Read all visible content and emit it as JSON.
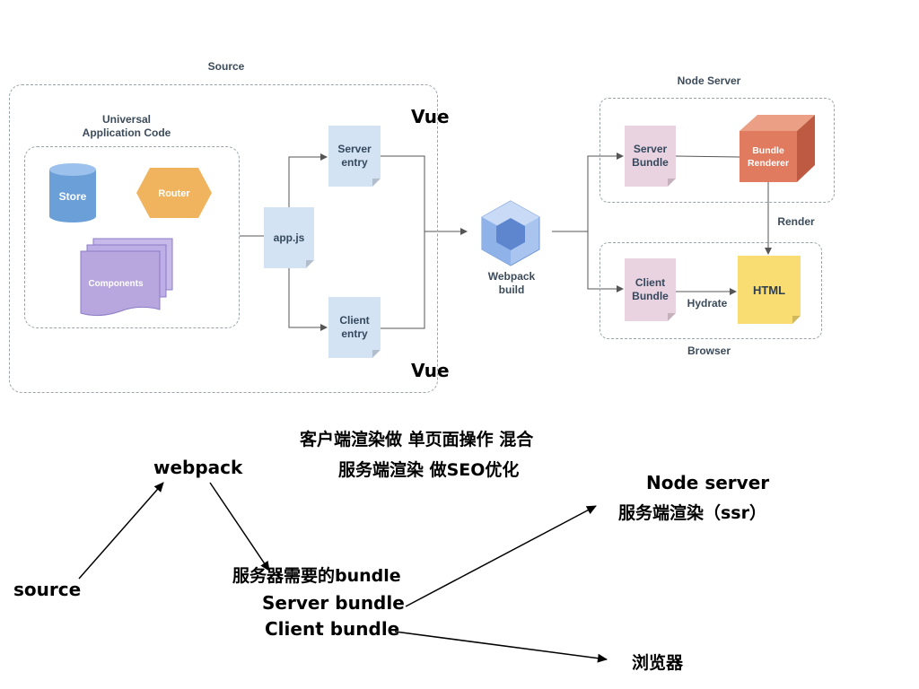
{
  "diagram": {
    "source_label": "Source",
    "universal_label": "Universal Application Code",
    "store": "Store",
    "router": "Router",
    "components": "Components",
    "app_js": "app.js",
    "server_entry": "Server entry",
    "client_entry": "Client entry",
    "vue_top": "Vue",
    "vue_bottom": "Vue",
    "webpack_build": "Webpack build",
    "node_server_label": "Node Server",
    "server_bundle": "Server Bundle",
    "bundle_renderer": "Bundle Renderer",
    "render": "Render",
    "client_bundle": "Client Bundle",
    "hydrate": "Hydrate",
    "html": "HTML",
    "browser_label": "Browser"
  },
  "notes": {
    "line1": "客户端渲染做 单页面操作  混合",
    "line2": "服务端渲染 做SEO优化",
    "webpack": "webpack",
    "source": "source",
    "server_needs": "服务器需要的bundle",
    "server_bundle": "Server bundle",
    "client_bundle": "Client bundle",
    "node_server": "Node server",
    "ssr": "服务端渲染（ssr）",
    "browser": "浏览器"
  },
  "colors": {
    "store": "#6b9fd8",
    "router": "#f0b45e",
    "components": "#b7a7de",
    "bundle_renderer": "#e07b5f",
    "html": "#f9dc72",
    "webpack_cube": "#8fb3e8"
  }
}
